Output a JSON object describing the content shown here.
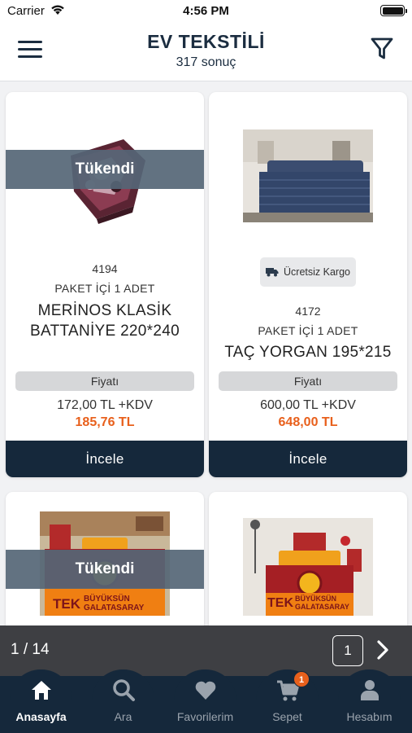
{
  "status": {
    "carrier": "Carrier",
    "time": "4:56 PM"
  },
  "header": {
    "title": "EV TEKSTİLİ",
    "subtitle": "317 sonuç"
  },
  "products": [
    {
      "code": "4194",
      "package": "PAKET İÇİ 1 ADET",
      "name": "MERİNOS KLASİK BATTANİYE 220*240",
      "badge": "Tükendi",
      "price_label": "Fiyatı",
      "price_net": "172,00 TL +KDV",
      "price_gross": "185,76 TL",
      "button": "İncele"
    },
    {
      "code": "4172",
      "package": "PAKET İÇİ 1 ADET",
      "name": "TAÇ YORGAN 195*215",
      "cargo": "Ücretsiz Kargo",
      "price_label": "Fiyatı",
      "price_net": "600,00 TL +KDV",
      "price_gross": "648,00 TL",
      "button": "İncele"
    },
    {
      "badge": "Tükendi",
      "image_text": "BÜYÜKSÜN GALATASARAY",
      "image_text_short": "TEK"
    },
    {
      "image_text": "BÜYÜKSÜN GALATASARAY",
      "image_text_short": "TEK"
    }
  ],
  "pagination": {
    "info": "1 / 14",
    "current": "1"
  },
  "tabs": [
    {
      "label": "Anasayfa",
      "icon": "home-icon",
      "active": true
    },
    {
      "label": "Ara",
      "icon": "search-icon"
    },
    {
      "label": "Favorilerim",
      "icon": "heart-icon"
    },
    {
      "label": "Sepet",
      "icon": "cart-icon",
      "badge": "1"
    },
    {
      "label": "Hesabım",
      "icon": "user-icon"
    }
  ],
  "colors": {
    "navy": "#15283b",
    "accent": "#e8601c",
    "overlay": "#556676",
    "pager": "#3e3f43"
  }
}
